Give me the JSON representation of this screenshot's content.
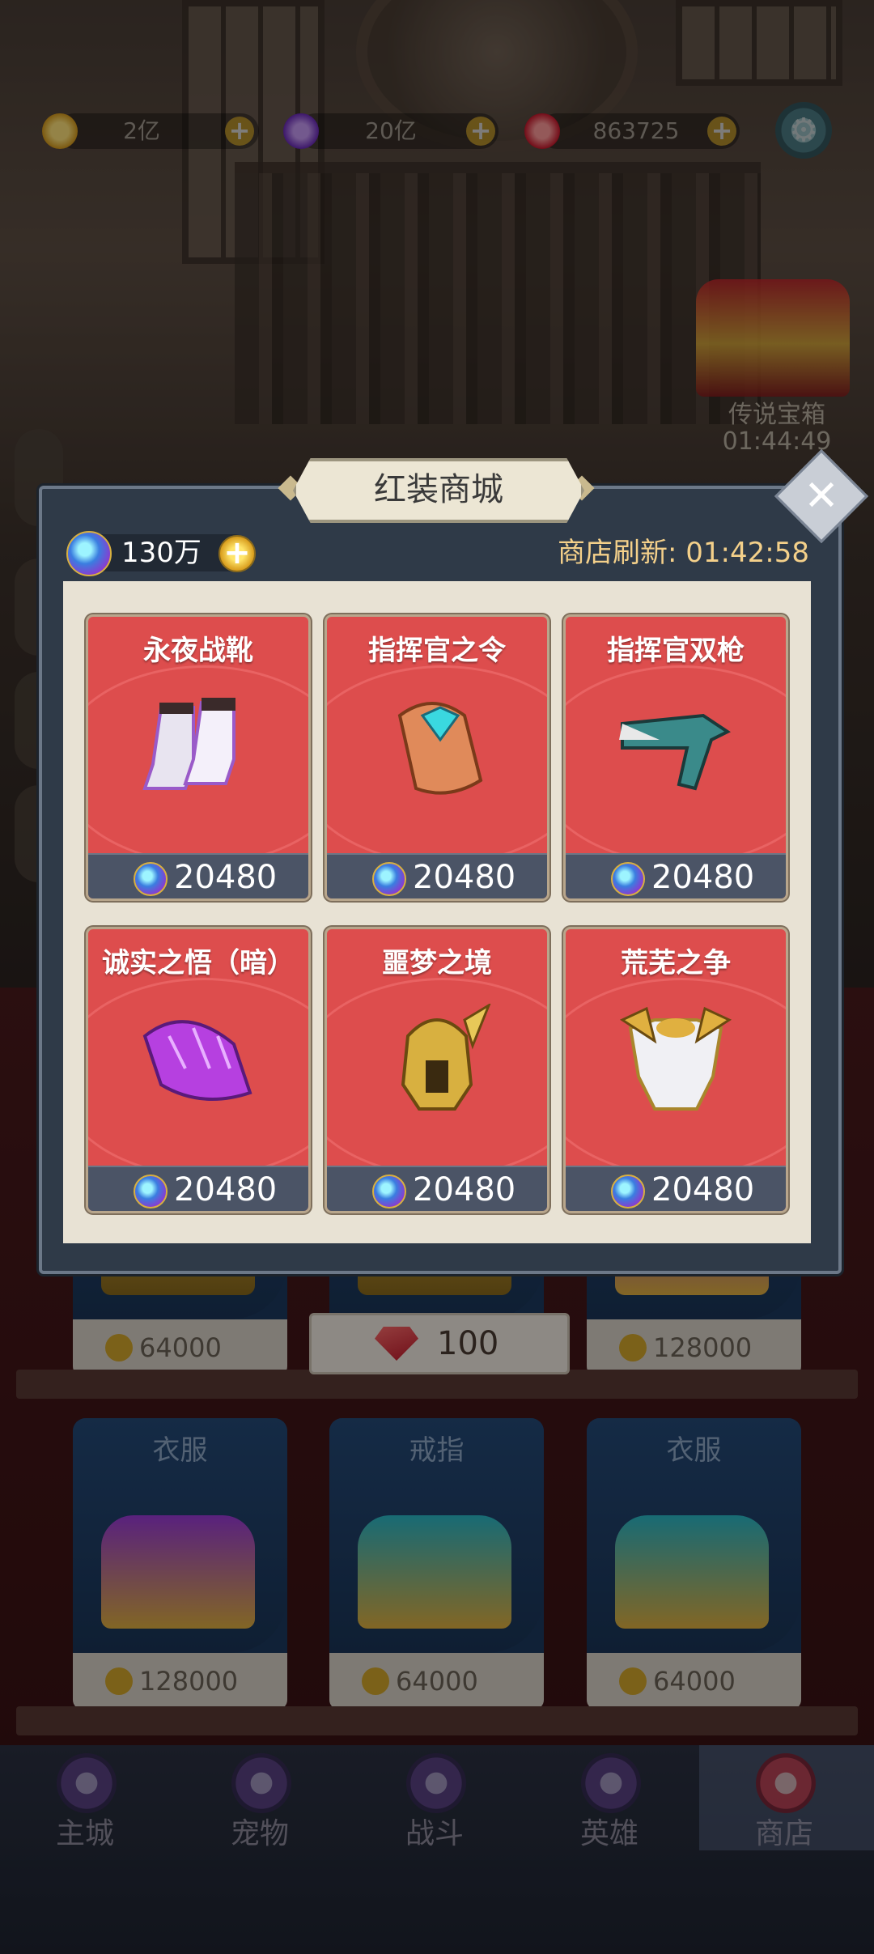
{
  "resources": {
    "gold": "2亿",
    "crystal": "20亿",
    "ruby": "863725"
  },
  "chest_event": {
    "label": "传说宝箱",
    "timer": "01:44:49"
  },
  "shop_dialog": {
    "title": "红装商城",
    "balance": "130万",
    "refresh_text": "商店刷新: 01:42:58",
    "items": [
      {
        "name": "永夜战靴",
        "price": "20480",
        "icon": "boots-icon"
      },
      {
        "name": "指挥官之令",
        "price": "20480",
        "icon": "bracer-icon"
      },
      {
        "name": "指挥官双枪",
        "price": "20480",
        "icon": "gun-icon"
      },
      {
        "name": "诚实之悟（暗）",
        "price": "20480",
        "icon": "shoulder-armor-icon"
      },
      {
        "name": "噩梦之境",
        "price": "20480",
        "icon": "helmet-icon"
      },
      {
        "name": "荒芜之争",
        "price": "20480",
        "icon": "chest-armor-icon"
      }
    ]
  },
  "background_shop": {
    "row1_prices": [
      "64000",
      "128000"
    ],
    "gem_button_value": "100",
    "row2": [
      {
        "title": "衣服",
        "price": "128000",
        "chest_color": "#9a3ad8"
      },
      {
        "title": "戒指",
        "price": "64000",
        "chest_color": "#2ab8c8"
      },
      {
        "title": "衣服",
        "price": "64000",
        "chest_color": "#2ab8c8"
      }
    ]
  },
  "bottom_nav": [
    {
      "label": "主城"
    },
    {
      "label": "宠物"
    },
    {
      "label": "战斗"
    },
    {
      "label": "英雄"
    },
    {
      "label": "商店",
      "active": true
    }
  ],
  "colors": {
    "card_red": "#dd4d4d",
    "dialog_bg": "#2f3a48",
    "refresh_gold": "#f4d08a"
  }
}
